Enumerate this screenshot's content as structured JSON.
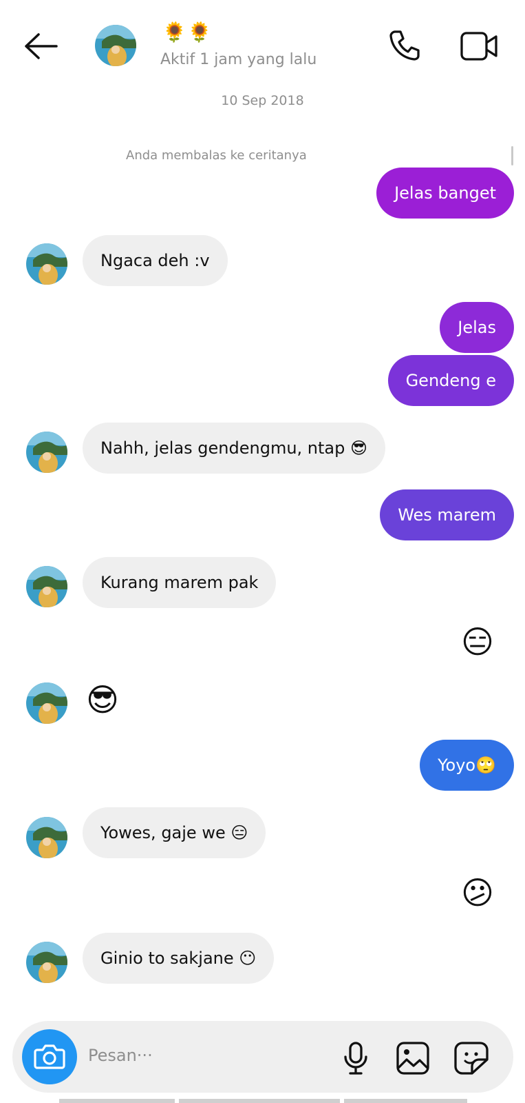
{
  "header": {
    "name": "🌻🌻",
    "status": "Aktif 1 jam yang lalu"
  },
  "date_label": "10 Sep 2018",
  "story_note": "Anda membalas ke ceritanya",
  "messages": [
    {
      "from": "me",
      "text": "Jelas banget",
      "color": "#9b1fd6"
    },
    {
      "from": "them",
      "text": "Ngaca deh :v"
    },
    {
      "from": "me",
      "text": "Jelas",
      "color": "#8d2ad8"
    },
    {
      "from": "me",
      "text": "Gendeng e",
      "color": "#7c33d9"
    },
    {
      "from": "them",
      "text": "Nahh, jelas gendengmu, ntap 😎"
    },
    {
      "from": "me",
      "text": "Wes marem",
      "color": "#6a42d9"
    },
    {
      "from": "them",
      "text": "Kurang marem pak"
    },
    {
      "from": "me",
      "emoji": "😑"
    },
    {
      "from": "them",
      "emoji": "😎"
    },
    {
      "from": "me",
      "text": "Yoyo🙄",
      "color": "#3172e6"
    },
    {
      "from": "them",
      "text": "Yowes, gaje we 😑"
    },
    {
      "from": "me",
      "emoji": "😕"
    },
    {
      "from": "them",
      "text": "Ginio to sakjane 😶"
    }
  ],
  "composer": {
    "placeholder": "Pesan···"
  },
  "icons": [
    "back-arrow-icon",
    "phone-icon",
    "video-call-icon",
    "camera-icon",
    "microphone-icon",
    "gallery-icon",
    "sticker-icon"
  ],
  "colors": {
    "camera_button": "#2196f3",
    "incoming_bubble": "#efefef"
  }
}
